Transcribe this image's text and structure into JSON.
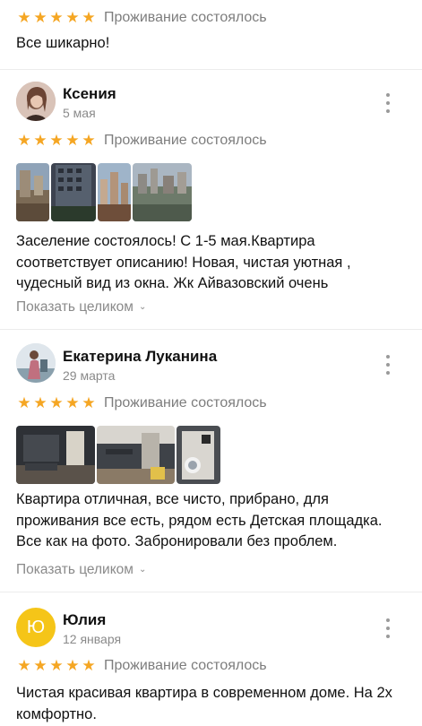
{
  "status_label": "Проживание состоялось",
  "rating_max": 5,
  "show_more_label": "Показать целиком",
  "reviews": [
    {
      "rating": 5,
      "text": "Все шикарно!"
    },
    {
      "author": "Ксения",
      "date": "5 мая",
      "rating": 5,
      "avatar_icon": "user-photo-icon",
      "text_lines": [
        "Заселение состоялось! С 1-5 мая.Квартира",
        "соответствует описанию! Новая, чистая уютная ,",
        "чудесный вид из окна. Жк Айвазовский очень"
      ],
      "photo_count": 4
    },
    {
      "author": "Екатерина Луканина",
      "date": "29 марта",
      "rating": 5,
      "avatar_icon": "user-photo-icon",
      "text_lines": [
        "Квартира отличная, все чисто, прибрано, для",
        "проживания все есть, рядом есть Детская площадка.",
        "Все как на фото. Забронировали без проблем."
      ],
      "photo_count": 3
    },
    {
      "author": "Юлия",
      "date": "12 января",
      "rating": 5,
      "avatar_letter": "Ю",
      "avatar_color": "#f5c518",
      "text_lines": [
        "Чистая красивая квартира в современном доме. На  2х",
        "комфортно."
      ]
    }
  ],
  "colors": {
    "star": "#f5a623",
    "muted": "#7d7d7d"
  }
}
